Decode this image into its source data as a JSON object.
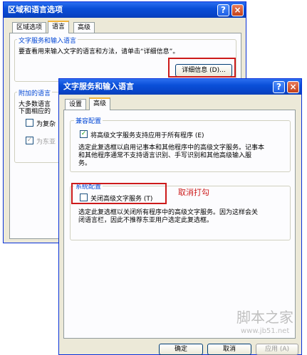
{
  "back_window": {
    "title": "区域和语言选项",
    "help_label": "?",
    "close_label": "×",
    "tabs": [
      {
        "label": "区域选项"
      },
      {
        "label": "语言"
      },
      {
        "label": "高级"
      }
    ],
    "text_services_group": {
      "title": "文字服务和输入语言",
      "description": "要查看用来输入文字的语言和方法，请单击“详细信息”。",
      "details_button": "详细信息 (D)..."
    },
    "extra_lang_group": {
      "title": "附加的语言",
      "line1": "大多数语言",
      "line2": "下面相应的",
      "check1": "为复杂",
      "check2": "为东亚"
    }
  },
  "front_window": {
    "title": "文字服务和输入语言",
    "help_label": "?",
    "close_label": "×",
    "tabs": [
      {
        "label": "设置"
      },
      {
        "label": "高级"
      }
    ],
    "compat_group": {
      "title": "兼容配置",
      "checkbox_label": "将高级文字服务支持应用于所有程序 (E)",
      "checkbox_mark": "✓",
      "desc_line1": "选定此复选框以启用记事本和其他程序中的高级文字服务。记事本",
      "desc_line2": "和其他程序通常不支持语言识别、手写识别和其他高级输入服",
      "desc_line3": "务。"
    },
    "system_group": {
      "title": "系统配置",
      "checkbox_label": "关闭高级文字服务 (T)",
      "desc_line1": "选定此复选框以关闭所有程序中的高级文字服务。因为这样会关",
      "desc_line2": "闭语言栏，因此不推荐东亚用户选定此复选框。"
    },
    "annotation": "取消打勾",
    "ok_button": "确定",
    "cancel_button": "取消",
    "apply_button": "应用 (A)"
  },
  "watermark": {
    "line1": "脚本之家",
    "line2": "www.jb51.net"
  },
  "colors": {
    "titlebar": "#0a4fd8",
    "annotation_red": "#cc1a1a",
    "group_label": "#0046d5"
  }
}
